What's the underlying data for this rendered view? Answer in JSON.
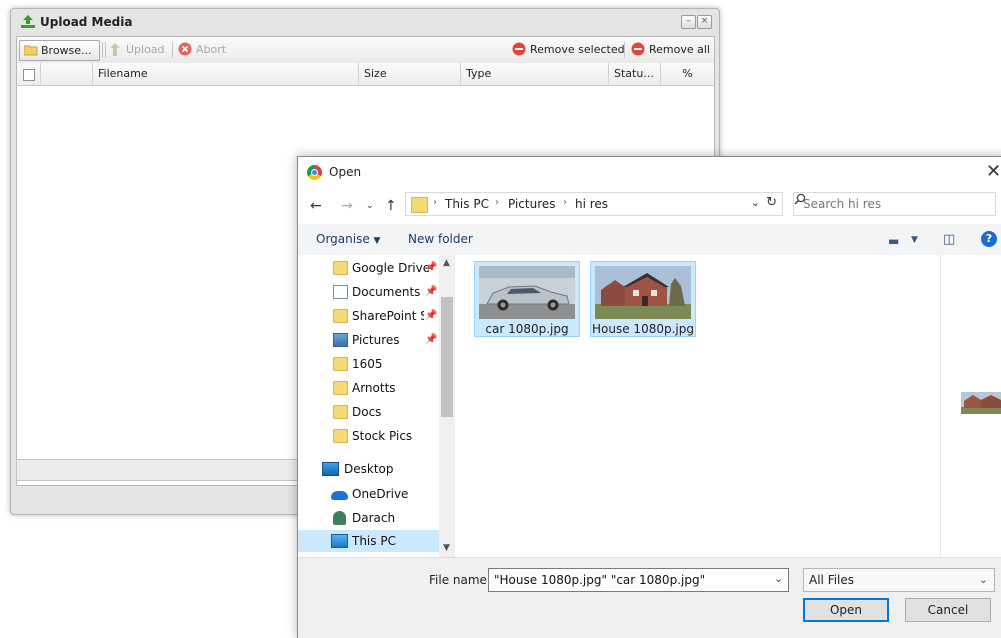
{
  "upload": {
    "title": "Upload Media",
    "toolbar": {
      "browse": "Browse...",
      "upload": "Upload",
      "abort": "Abort",
      "remove_selected": "Remove selected",
      "remove_all": "Remove all"
    },
    "columns": [
      "Filename",
      "Size",
      "Type",
      "Statu...",
      "%"
    ]
  },
  "dialog": {
    "title": "Open",
    "breadcrumbs": [
      "This PC",
      "Pictures",
      "hi res"
    ],
    "search_placeholder": "Search hi res",
    "commands": {
      "organise": "Organise",
      "new_folder": "New folder"
    },
    "nav": [
      {
        "label": "Google Drive",
        "icon": "folder-icon",
        "pinned": true
      },
      {
        "label": "Documents",
        "icon": "document-icon",
        "pinned": true
      },
      {
        "label": "SharePoint Si",
        "icon": "folder-icon",
        "pinned": true
      },
      {
        "label": "Pictures",
        "icon": "pictures-icon",
        "pinned": true
      },
      {
        "label": "1605",
        "icon": "folder-icon"
      },
      {
        "label": "Arnotts",
        "icon": "folder-icon"
      },
      {
        "label": "Docs",
        "icon": "folder-icon"
      },
      {
        "label": "Stock Pics",
        "icon": "folder-icon"
      },
      {
        "label": "Desktop",
        "icon": "desktop-icon"
      },
      {
        "label": "OneDrive",
        "icon": "onedrive-icon"
      },
      {
        "label": "Darach",
        "icon": "user-icon"
      },
      {
        "label": "This PC",
        "icon": "this-pc-icon",
        "selected": true
      }
    ],
    "files": [
      {
        "name": "car 1080p.jpg",
        "selected": true
      },
      {
        "name": "House 1080p.jpg",
        "selected": true
      }
    ],
    "file_name_label": "File name:",
    "file_name_value": "\"House 1080p.jpg\" \"car 1080p.jpg\"",
    "file_type": "All Files",
    "open_button": "Open",
    "cancel_button": "Cancel"
  }
}
